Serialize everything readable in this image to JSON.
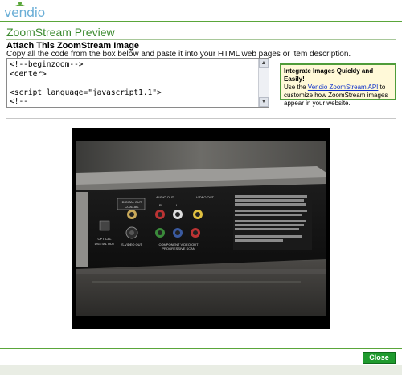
{
  "brand": {
    "logo_text": "vendio"
  },
  "section": {
    "title": "ZoomStream Preview"
  },
  "attach": {
    "title": "Attach This ZoomStream Image",
    "description": "Copy all the code from the box below and paste it into your HTML web pages or item description."
  },
  "code": {
    "content": "<!--beginzoom-->\n<center>\n\n<script language=\"javascript1.1\">\n<!--"
  },
  "promo": {
    "title": "Integrate Images Quickly and Easily!",
    "pre_link": "Use the ",
    "link": "Vendio ZoomStream API",
    "post_link": " to customize how ZoomStream images appear in your website."
  },
  "photo": {
    "labels": {
      "digital_out": "DIGITAL OUT",
      "coaxial": "COAXIAL",
      "audio_out": "AUDIO OUT",
      "video_out": "VIDEO OUT",
      "r": "R",
      "l": "L",
      "optical": "OPTICAL",
      "digital_out_2": "DIGITAL OUT",
      "s_video_out": "S-VIDEO OUT",
      "component": "COMPONENT VIDEO OUT",
      "progressive": "PROGRESSIVE SCAN"
    }
  },
  "footer": {
    "close_label": "Close"
  },
  "colors": {
    "green": "#5aa63a",
    "title_green": "#3b8a2f",
    "button_green": "#1f9a2e",
    "promo_bg": "#fff9d8",
    "link_blue": "#1133cc"
  }
}
